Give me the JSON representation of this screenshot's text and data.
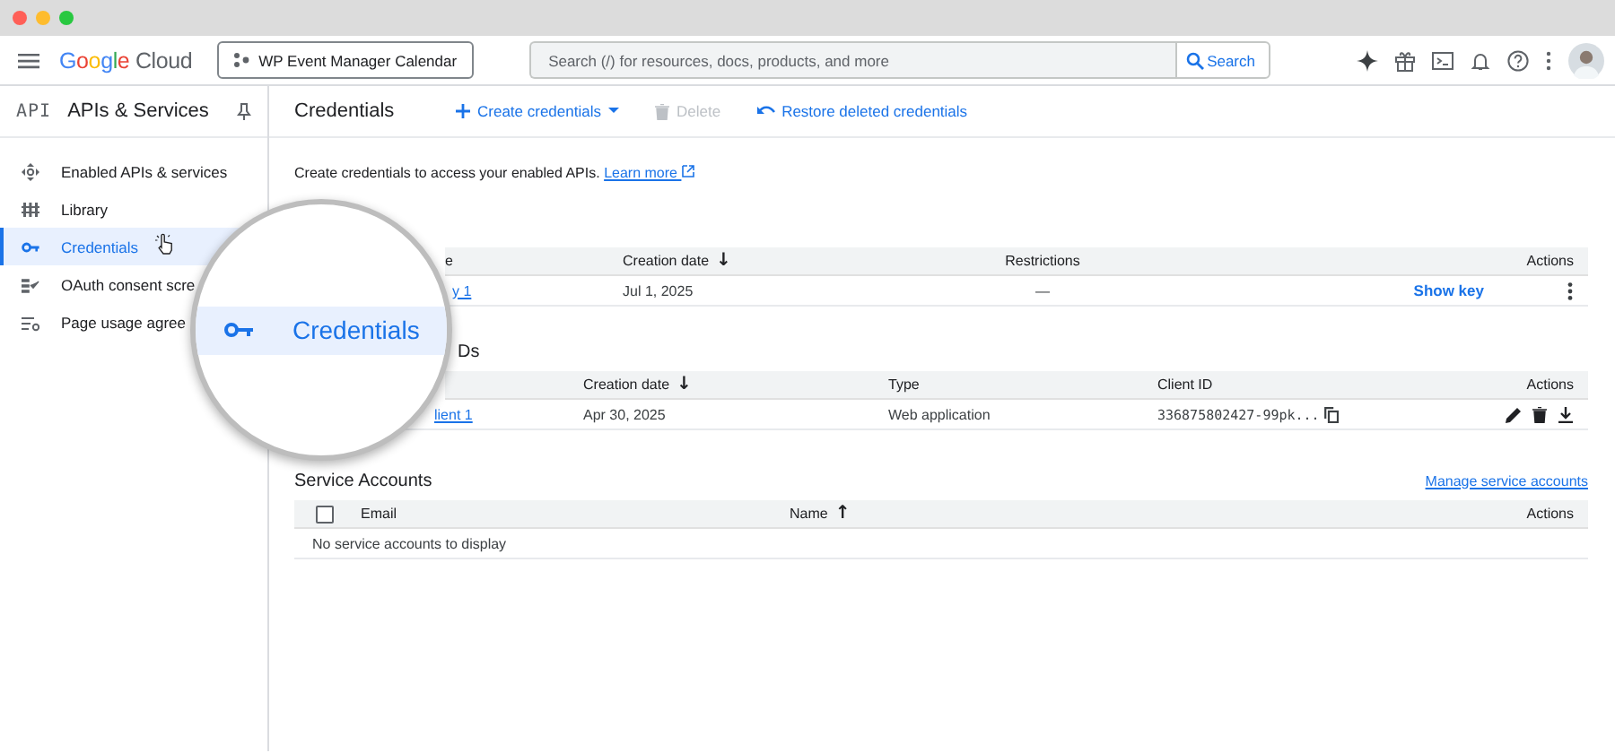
{
  "window": {
    "controls": [
      {
        "color": "#ff5f57"
      },
      {
        "color": "#febc2e"
      },
      {
        "color": "#28c840"
      }
    ]
  },
  "header": {
    "logo": "Google Cloud",
    "project": "WP Event Manager Calendar",
    "search": {
      "placeholder": "Search (/) for resources, docs, products, and more",
      "button": "Search"
    }
  },
  "sidebar": {
    "icon_text": "API",
    "title": "APIs & Services",
    "items": [
      {
        "label": "Enabled APIs & services",
        "selected": false,
        "kind": "apis"
      },
      {
        "label": "Library",
        "selected": false,
        "kind": "library"
      },
      {
        "label": "Credentials",
        "selected": true,
        "kind": "key"
      },
      {
        "label": "OAuth consent scre",
        "selected": false,
        "kind": "consent"
      },
      {
        "label": "Page usage agree",
        "selected": false,
        "kind": "agreement"
      }
    ]
  },
  "toolbar": {
    "title": "Credentials",
    "actions": [
      {
        "label": "Create credentials",
        "disabled": false,
        "kind": "create"
      },
      {
        "label": "Delete",
        "disabled": true,
        "kind": "delete"
      },
      {
        "label": "Restore deleted credentials",
        "disabled": false,
        "kind": "restore"
      }
    ]
  },
  "intro": {
    "text": "Create credentials to access your enabled APIs.",
    "link": "Learn more"
  },
  "api_keys": {
    "columns": [
      {
        "label": "e"
      },
      {
        "label": "Creation date",
        "arrow": "↓"
      },
      {
        "label": "Restrictions"
      },
      {
        "label": "Actions"
      }
    ],
    "rows": [
      {
        "name": "y 1",
        "date": "Jul 1, 2025",
        "restrictions": "—",
        "action": "Show key"
      }
    ]
  },
  "oauth_clients": {
    "title": "Ds",
    "columns": [
      {
        "label": "Creation date",
        "arrow": "↓"
      },
      {
        "label": "Type"
      },
      {
        "label": "Client ID"
      },
      {
        "label": "Actions"
      }
    ],
    "rows": [
      {
        "name": "lient 1",
        "date": "Apr 30, 2025",
        "type": "Web application",
        "client_id": "336875802427-99pk..."
      }
    ]
  },
  "service_accounts": {
    "title": "Service Accounts",
    "link": "Manage service accounts",
    "select_all": {
      "checked": false
    },
    "columns": [
      {
        "label": "Email"
      },
      {
        "label": "Name",
        "arrow": "↑"
      },
      {
        "label": "Actions"
      }
    ],
    "empty": "No service accounts to display"
  },
  "magnifier": {
    "label": "Credentials"
  }
}
